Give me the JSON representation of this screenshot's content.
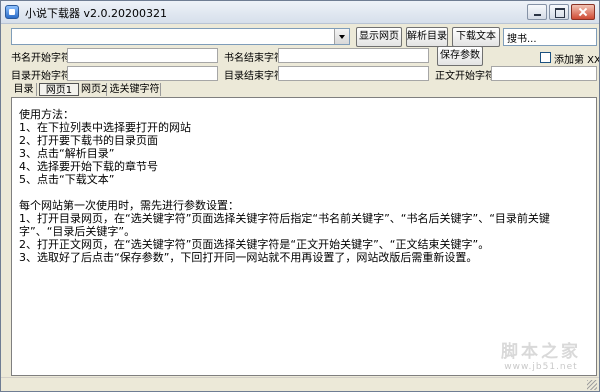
{
  "window": {
    "title": "小说下载器 v2.0.20200321"
  },
  "toolbar": {
    "url_value": "",
    "show_page_label": "显示网页",
    "parse_catalog_label": "解析目录",
    "download_text_label": "下载文本",
    "search_placeholder": "搜书..."
  },
  "params": {
    "book_start_label": "书名开始字符:",
    "book_start_value": "",
    "book_end_label": "书名结束字符:",
    "book_end_value": "",
    "save_label": "保存参数",
    "add_chapter_label": "添加第 XX 章",
    "catalog_start_label": "目录开始字符:",
    "catalog_start_value": "",
    "catalog_end_label": "目录结束字符:",
    "catalog_end_value": "",
    "text_start_label": "正文开始字符:",
    "text_start_value": ""
  },
  "tabs": [
    {
      "label": "目录"
    },
    {
      "label": "网页1"
    },
    {
      "label": "网页2"
    },
    {
      "label": "选关键字符"
    }
  ],
  "active_tab": "网页1",
  "content": {
    "lines": [
      "使用方法：",
      "1、在下拉列表中选择要打开的网站",
      "2、打开要下载书的目录页面",
      "3、点击“解析目录”",
      "4、选择要开始下载的章节号",
      "5、点击“下载文本”",
      "",
      "每个网站第一次使用时，需先进行参数设置：",
      "1、打开目录网页，在“选关键字符”页面选择关键字符后指定“书名前关键字”、“书名后关键字”、“目录前关键字”、“目录后关键字”。",
      "2、打开正文网页，在“选关键字符”页面选择关键字符是“正文开始关键字”、“正文结束关键字”。",
      "3、选取好了后点击“保存参数”，下回打开同一网站就不用再设置了，网站改版后需重新设置。"
    ]
  },
  "watermark": {
    "text": "脚本之家",
    "url": "www.jb51.net"
  }
}
